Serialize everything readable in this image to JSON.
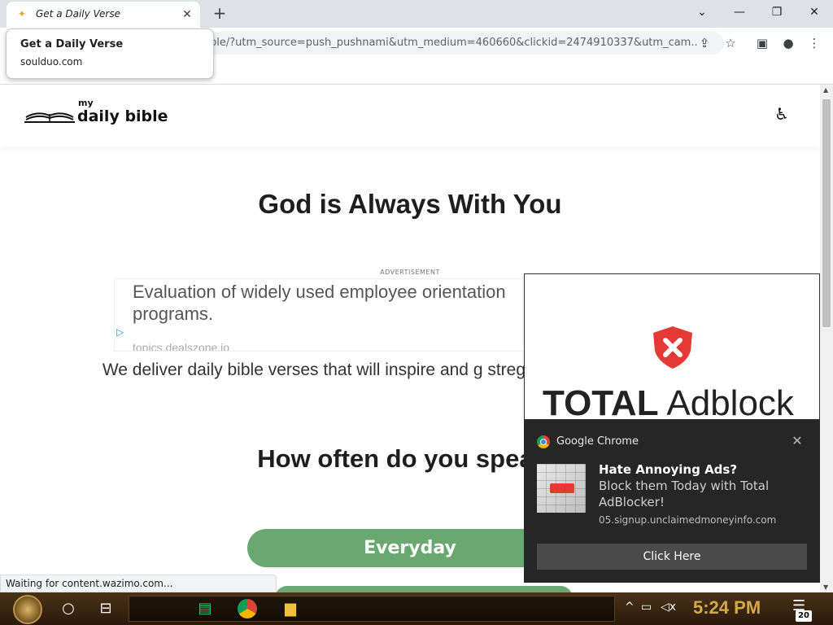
{
  "browser": {
    "tab_title": "Get a Daily Verse",
    "tab_close": "✕",
    "new_tab": "+",
    "url": "ble/?utm_source=push_pushnami&utm_medium=460660&clickid=2474910337&utm_cam...",
    "win_minimize": "⌄",
    "tooltip_title": "Get a Daily Verse",
    "tooltip_domain": "soulduo.com",
    "status_text": "Waiting for content.wazimo.com..."
  },
  "site": {
    "logo_small": "my",
    "logo_main": "daily bible",
    "heading": "God is Always With You",
    "ad_label": "ADVERTISEMENT",
    "ad_text": "Evaluation of widely used employee orientation programs.",
    "ad_domain": "topics.dealszone.io",
    "intro": "We deliver daily bible verses that will inspire and g stregthen your connection with",
    "question": "How often do you speak t",
    "option_1": "Everyday"
  },
  "popup": {
    "brand_bold": "TOTAL",
    "brand_light": " Adblock"
  },
  "notification": {
    "app_name": "Google Chrome",
    "title": "Hate Annoying Ads?",
    "body": "Block them Today with Total AdBlocker!",
    "source": "05.signup.unclaimedmoneyinfo.com",
    "action": "Click Here"
  },
  "taskbar": {
    "clock": "5:24 PM",
    "notif_count": "20"
  },
  "colors": {
    "accent_green": "#6aa871",
    "shield_red": "#e53935",
    "notification_bg": "#262626"
  }
}
